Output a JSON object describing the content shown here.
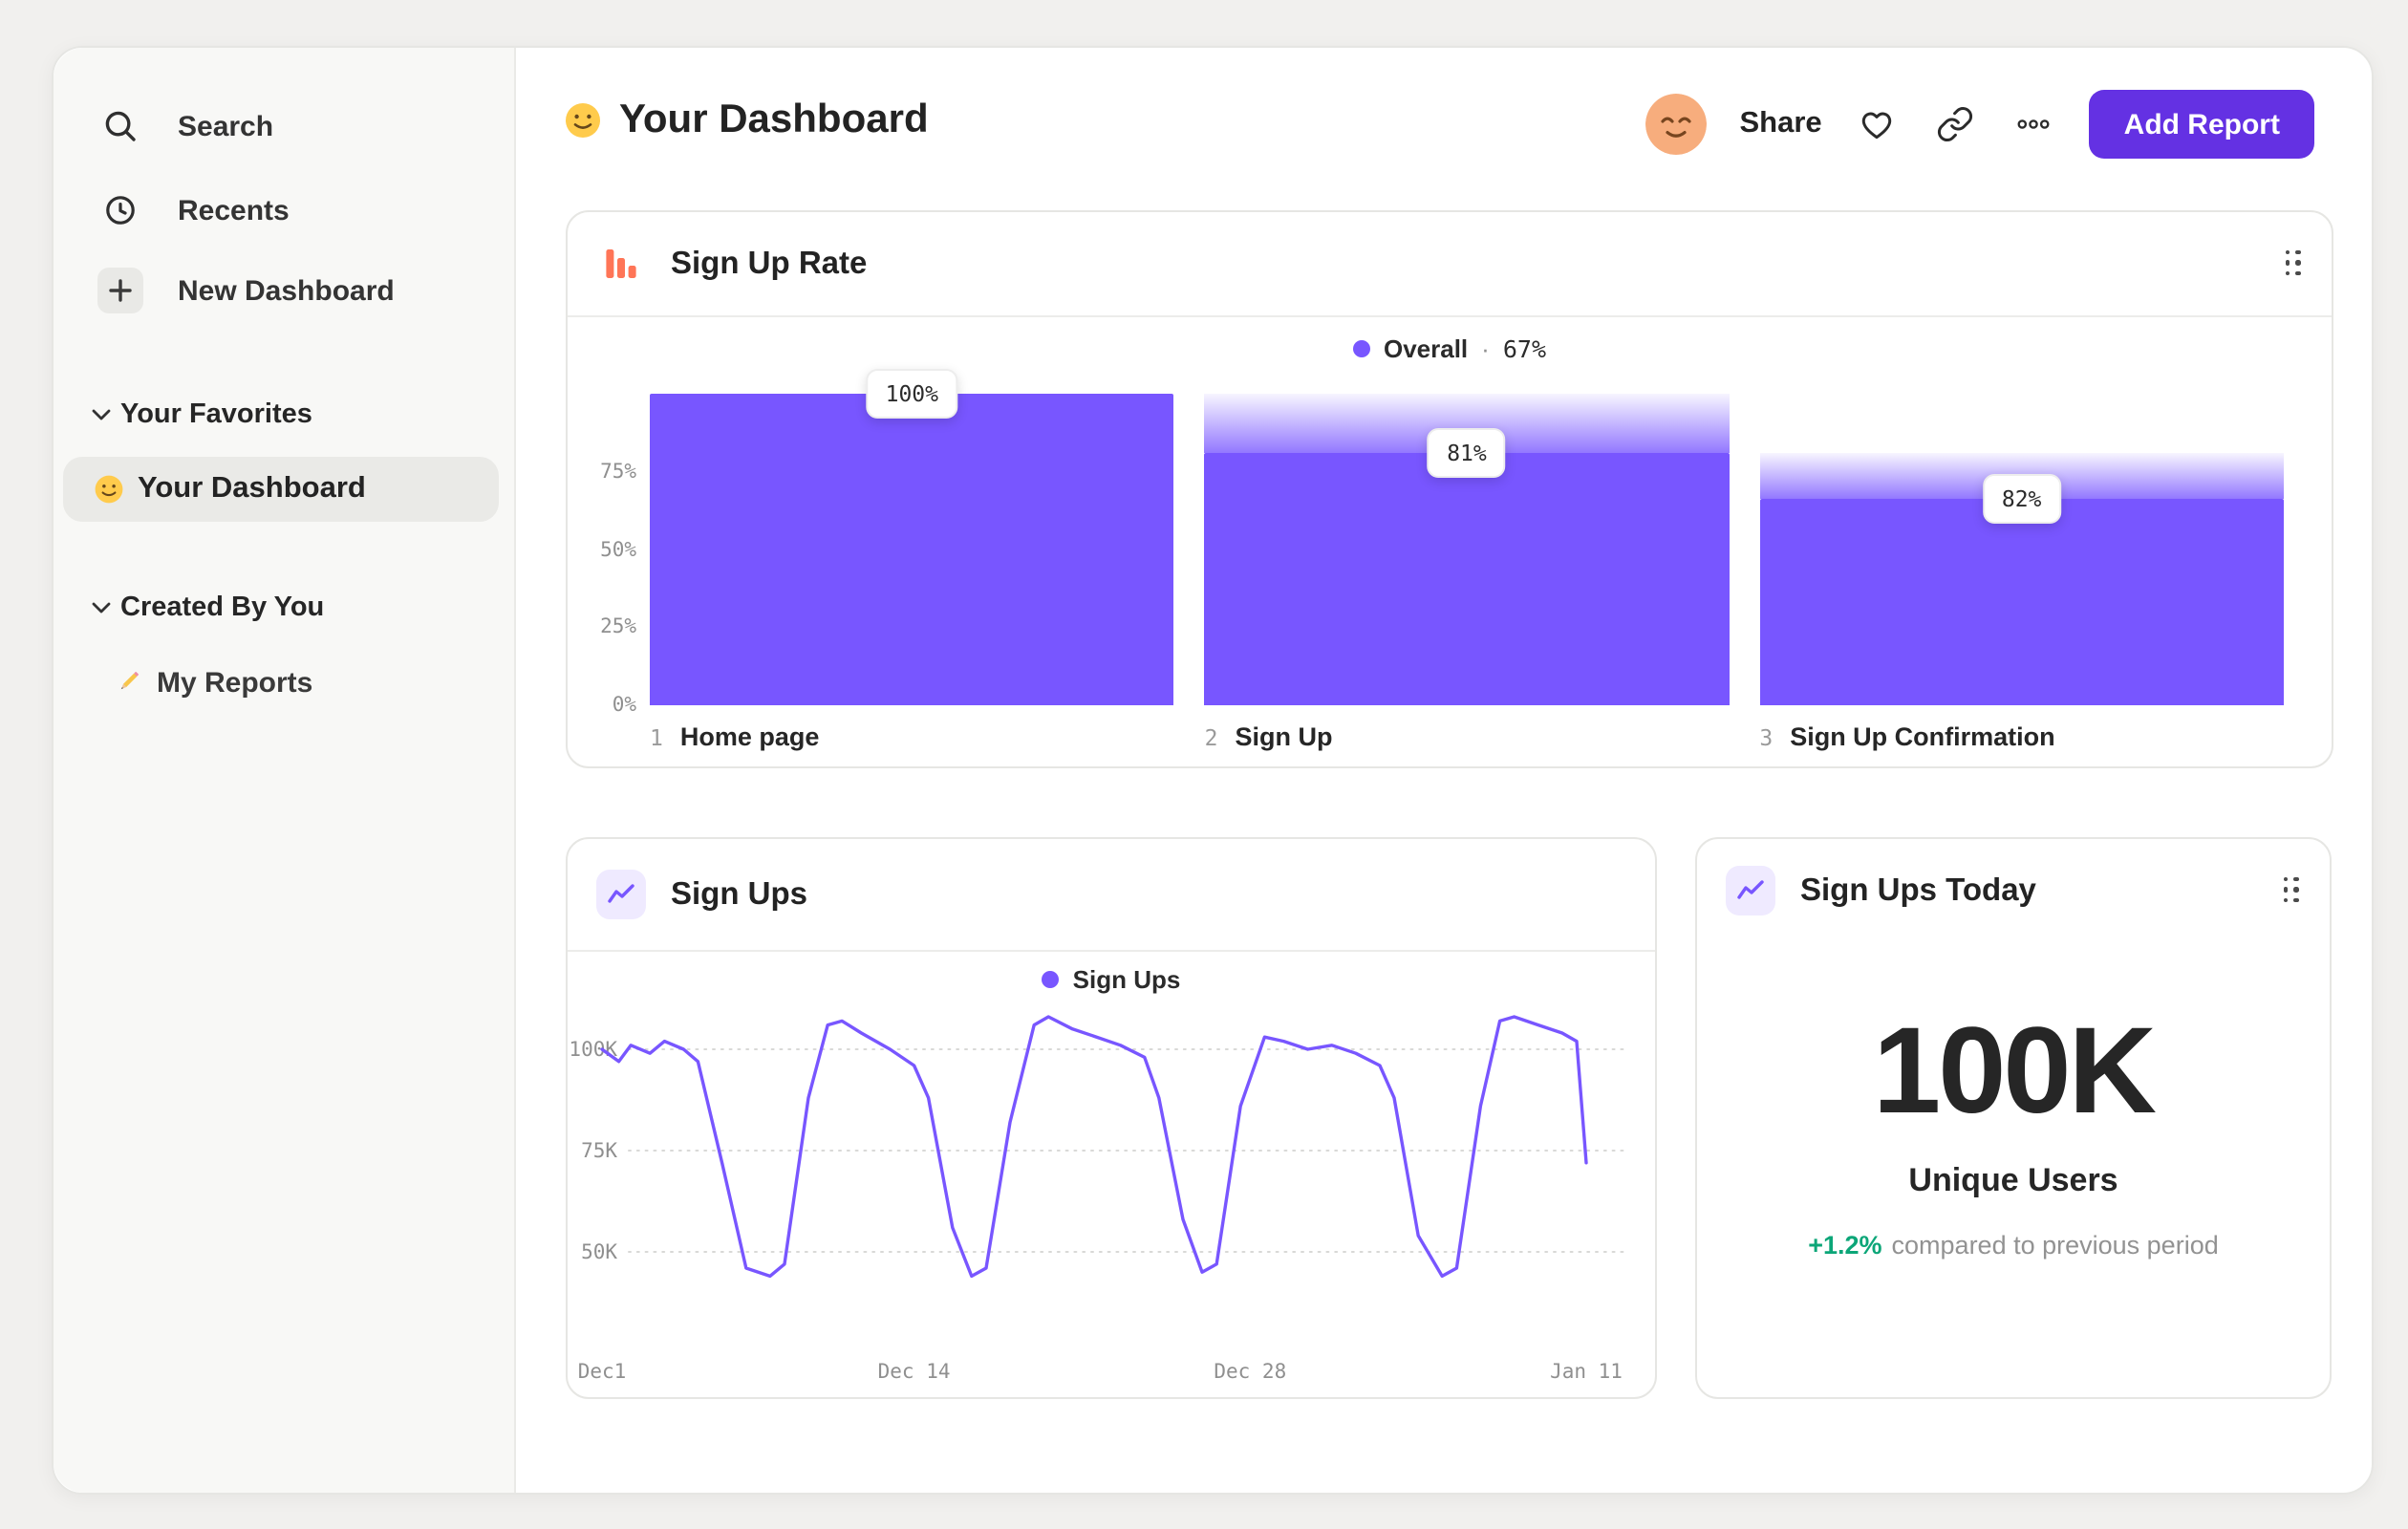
{
  "colors": {
    "accent_purple": "#7856FF",
    "button_purple": "#6431E3",
    "funnel_orange": "#FF7557",
    "delta_green": "#0CA678"
  },
  "icons": {
    "search": "magnifier",
    "recents": "clock",
    "new_dashboard": "plus",
    "favorites_chevron": "chevron-down",
    "funnel_report": "orange-bar-chart",
    "line_report": "purple-line-chart",
    "heart": "heart-outline",
    "link": "chain-link",
    "more": "three-dots",
    "drag": "six-dot-handle"
  },
  "sidebar": {
    "items": [
      {
        "label": "Search"
      },
      {
        "label": "Recents"
      },
      {
        "label": "New Dashboard"
      }
    ],
    "favorites": {
      "title": "Your Favorites",
      "items": [
        {
          "label": "Your Dashboard",
          "selected": true
        }
      ]
    },
    "created": {
      "title": "Created By You",
      "items": [
        {
          "label": "My Reports"
        }
      ]
    }
  },
  "header": {
    "title": "Your Dashboard",
    "share": "Share",
    "add_report": "Add Report"
  },
  "cards": {
    "funnel": {
      "title": "Sign Up Rate",
      "legend_label": "Overall",
      "legend_sep": "·",
      "legend_value": "67%"
    },
    "line": {
      "title": "Sign Ups",
      "legend_label": "Sign Ups"
    },
    "stat": {
      "title": "Sign Ups Today",
      "value": "100K",
      "metric": "Unique Users",
      "delta": "+1.2%",
      "delta_text": "compared to previous period"
    }
  },
  "chart_data": [
    {
      "type": "funnel-bar",
      "title": "Sign Up Rate",
      "legend": [
        {
          "label": "Overall",
          "value": "67%"
        }
      ],
      "ylim_pct": [
        0,
        100
      ],
      "y_ticks": [
        {
          "pct": 75,
          "label": "75%"
        },
        {
          "pct": 50,
          "label": "50%"
        },
        {
          "pct": 25,
          "label": "25%"
        },
        {
          "pct": 0,
          "label": "0%"
        }
      ],
      "steps": [
        {
          "step": 1,
          "name": "Home page",
          "display": "100%",
          "bar_pct": 100,
          "prev_bar_pct": 100
        },
        {
          "step": 2,
          "name": "Sign Up",
          "display": "81%",
          "bar_pct": 81,
          "prev_bar_pct": 100
        },
        {
          "step": 3,
          "name": "Sign Up Confirmation",
          "display": "82%",
          "bar_pct": 66.4,
          "prev_bar_pct": 81
        }
      ],
      "overall_conversion": "67%"
    },
    {
      "type": "line",
      "title": "Sign Ups",
      "legend_position": "top-center",
      "grid": "dotted-horizontal",
      "x_ticks": [
        {
          "day": 0,
          "label": "Dec1"
        },
        {
          "day": 13,
          "label": "Dec 14"
        },
        {
          "day": 27,
          "label": "Dec 28"
        },
        {
          "day": 41,
          "label": "Jan 11"
        }
      ],
      "y_ticks": [
        {
          "value_k": 100,
          "label": "100K"
        },
        {
          "value_k": 75,
          "label": "75K"
        },
        {
          "value_k": 50,
          "label": "50K"
        }
      ],
      "ylim_k": [
        40,
        112
      ],
      "series": [
        {
          "name": "Sign Ups",
          "color": "#7856FF",
          "points_day_value_k": [
            [
              0,
              100
            ],
            [
              0.7,
              97
            ],
            [
              1.2,
              101
            ],
            [
              2,
              99
            ],
            [
              2.6,
              102
            ],
            [
              3.4,
              100
            ],
            [
              4,
              97
            ],
            [
              5,
              72
            ],
            [
              6,
              46
            ],
            [
              7,
              44
            ],
            [
              7.6,
              47
            ],
            [
              8.6,
              88
            ],
            [
              9.4,
              106
            ],
            [
              10,
              107
            ],
            [
              10.8,
              104
            ],
            [
              12,
              100
            ],
            [
              13,
              96
            ],
            [
              13.6,
              88
            ],
            [
              14.6,
              56
            ],
            [
              15.4,
              44
            ],
            [
              16,
              46
            ],
            [
              17,
              82
            ],
            [
              18,
              106
            ],
            [
              18.6,
              108
            ],
            [
              19.6,
              105
            ],
            [
              20.6,
              103
            ],
            [
              21.6,
              101
            ],
            [
              22.6,
              98
            ],
            [
              23.2,
              88
            ],
            [
              24.2,
              58
            ],
            [
              25,
              45
            ],
            [
              25.6,
              47
            ],
            [
              26.6,
              86
            ],
            [
              27.6,
              103
            ],
            [
              28.4,
              102
            ],
            [
              29.4,
              100
            ],
            [
              30.4,
              101
            ],
            [
              31.4,
              99
            ],
            [
              32.4,
              96
            ],
            [
              33,
              88
            ],
            [
              34,
              54
            ],
            [
              35,
              44
            ],
            [
              35.6,
              46
            ],
            [
              36.6,
              86
            ],
            [
              37.4,
              107
            ],
            [
              38,
              108
            ],
            [
              39,
              106
            ],
            [
              40,
              104
            ],
            [
              40.6,
              102
            ],
            [
              41,
              72
            ]
          ]
        }
      ]
    },
    {
      "type": "big-number",
      "title": "Sign Ups Today",
      "value": "100K",
      "metric": "Unique Users",
      "change_pct": "+1.2%",
      "change_note": "compared to previous period"
    }
  ]
}
